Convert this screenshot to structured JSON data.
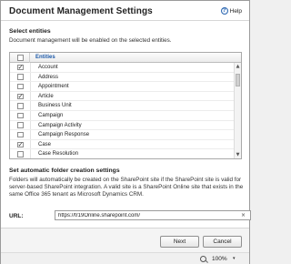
{
  "dialog": {
    "title": "Document Management Settings",
    "help_label": "Help",
    "help_icon": "?"
  },
  "entities_section": {
    "title": "Select entities",
    "description": "Document management will be enabled on the selected entities.",
    "column_header": "Entities",
    "rows": [
      {
        "label": "Account",
        "checked": true
      },
      {
        "label": "Address",
        "checked": false
      },
      {
        "label": "Appointment",
        "checked": false
      },
      {
        "label": "Article",
        "checked": true
      },
      {
        "label": "Business Unit",
        "checked": false
      },
      {
        "label": "Campaign",
        "checked": false
      },
      {
        "label": "Campaign Activity",
        "checked": false
      },
      {
        "label": "Campaign Response",
        "checked": false
      },
      {
        "label": "Case",
        "checked": true
      },
      {
        "label": "Case Resolution",
        "checked": false
      }
    ]
  },
  "folder_section": {
    "title": "Set automatic folder creation settings",
    "description": "Folders will automatically be created on the SharePoint site if the SharePoint site is valid for server-based SharePoint integration. A valid site is a SharePoint Online site that exists in the same Office 365 tenant as Microsoft Dynamics CRM."
  },
  "url": {
    "label": "URL:",
    "value": "https://tr19Online.sharepoint.com/",
    "clear_glyph": "×"
  },
  "buttons": {
    "next": "Next",
    "cancel": "Cancel"
  },
  "statusbar": {
    "zoom": "100%",
    "zoom_caret": "▾"
  },
  "scrollbar": {
    "up": "▲",
    "down": "▼"
  }
}
